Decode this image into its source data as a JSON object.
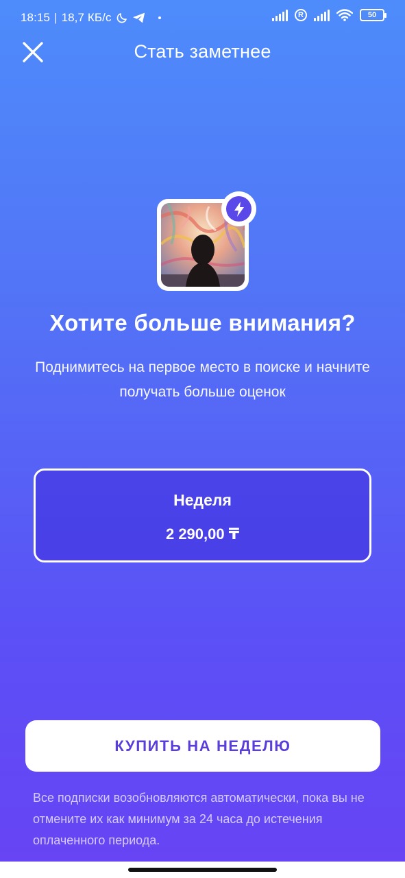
{
  "status_bar": {
    "time": "18:15",
    "separator": "|",
    "network_speed": "18,7 КБ/с",
    "icons": [
      "moon-icon",
      "telegram-icon",
      "signal-icon",
      "roaming-icon",
      "signal-icon",
      "wifi-icon",
      "battery-icon"
    ],
    "roaming_label": "R",
    "battery_level": "50"
  },
  "header": {
    "title": "Стать заметнее",
    "close_icon": "close-icon"
  },
  "avatar": {
    "badge_icon": "lightning-icon",
    "badge_color": "#5b48e9"
  },
  "promo": {
    "headline": "Хотите больше внимания?",
    "description": "Поднимитесь на первое место в поиске и начните получать больше оценок"
  },
  "plan": {
    "name": "Неделя",
    "price": "2 290,00 ₸"
  },
  "buy_button": {
    "label": "КУПИТЬ НА НЕДЕЛЮ",
    "text_color": "#5a3ed9"
  },
  "disclaimer": "Все подписки возобновляются автоматически, пока вы не отмените их как минимум за 24 часа до истечения оплаченного периода.",
  "colors": {
    "background_top": "#4e8cfb",
    "background_bottom": "#6843f4",
    "accent": "#5b48e9"
  }
}
